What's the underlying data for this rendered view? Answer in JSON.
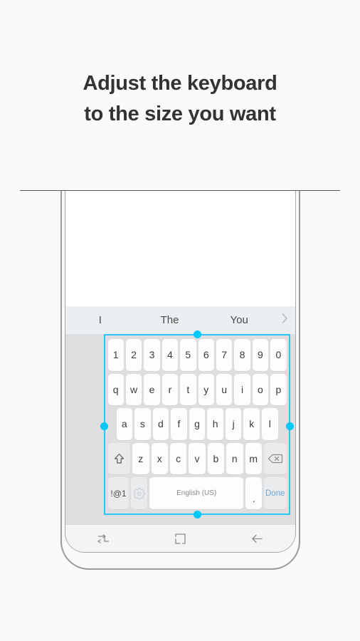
{
  "headline": {
    "line1": "Adjust the keyboard",
    "line2": "to the size you want"
  },
  "colors": {
    "accent_cyan": "#29c5f6",
    "handle_cyan": "#00c8f8",
    "done_blue": "#6aa8d8",
    "page_bg": "#fafafa",
    "keyboard_bg": "#dcdee0",
    "suggestion_bg": "#eceff1",
    "key_bg": "#fdfdfd",
    "func_key_bg": "#e9ebed",
    "heading_text": "#333333"
  },
  "phone": {
    "suggestions": [
      {
        "label": "I"
      },
      {
        "label": "The"
      },
      {
        "label": "You"
      }
    ],
    "suggestion_expand_icon": "chevron-right-icon",
    "navbar": [
      {
        "name": "recents-button",
        "icon": "recents-icon"
      },
      {
        "name": "home-button",
        "icon": "home-square-icon"
      },
      {
        "name": "back-button",
        "icon": "back-arrow-icon"
      }
    ]
  },
  "keyboard": {
    "language_label": "English (US)",
    "done_label": "Done",
    "symbols_label": "!@1",
    "period_label": ".",
    "settings_icon": "gear-icon",
    "shift_icon": "shift-arrow-icon",
    "backspace_icon": "backspace-icon",
    "rows": [
      {
        "name": "number-row",
        "keys": [
          "1",
          "2",
          "3",
          "4",
          "5",
          "6",
          "7",
          "8",
          "9",
          "0"
        ]
      },
      {
        "name": "top-letter-row",
        "keys": [
          "q",
          "w",
          "e",
          "r",
          "t",
          "y",
          "u",
          "i",
          "o",
          "p"
        ]
      },
      {
        "name": "home-letter-row",
        "keys": [
          "a",
          "s",
          "d",
          "f",
          "g",
          "h",
          "j",
          "k",
          "l"
        ]
      },
      {
        "name": "bottom-letter-row",
        "keys": [
          "z",
          "x",
          "c",
          "v",
          "b",
          "n",
          "m"
        ]
      }
    ],
    "resize_handles": [
      {
        "name": "resize-handle-top",
        "position": "top-center"
      },
      {
        "name": "resize-handle-bottom",
        "position": "bottom-center"
      },
      {
        "name": "resize-handle-left",
        "position": "left-middle"
      },
      {
        "name": "resize-handle-right",
        "position": "right-middle"
      }
    ]
  }
}
